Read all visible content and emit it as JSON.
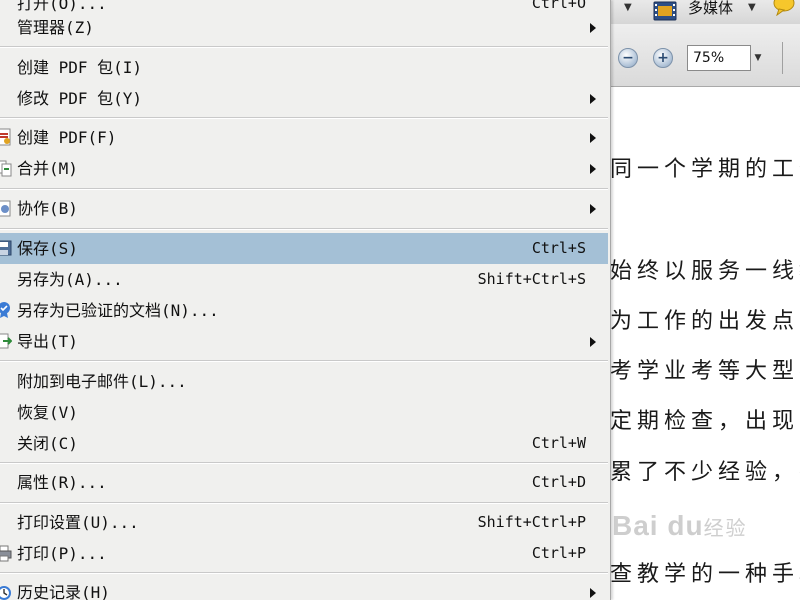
{
  "menu": {
    "items": [
      {
        "label": "打开(O)...",
        "shortcut": "Ctrl+O"
      },
      {
        "label": "管理器(Z)"
      },
      {
        "label": "创建 PDF 包(I)"
      },
      {
        "label": "修改 PDF 包(Y)"
      },
      {
        "label": "创建 PDF(F)"
      },
      {
        "label": "合并(M)"
      },
      {
        "label": "协作(B)"
      },
      {
        "label": "保存(S)",
        "shortcut": "Ctrl+S"
      },
      {
        "label": "另存为(A)...",
        "shortcut": "Shift+Ctrl+S"
      },
      {
        "label": "另存为已验证的文档(N)..."
      },
      {
        "label": "导出(T)"
      },
      {
        "label": "附加到电子邮件(L)..."
      },
      {
        "label": "恢复(V)"
      },
      {
        "label": "关闭(C)",
        "shortcut": "Ctrl+W"
      },
      {
        "label": "属性(R)...",
        "shortcut": "Ctrl+D"
      },
      {
        "label": "打印设置(U)...",
        "shortcut": "Shift+Ctrl+P"
      },
      {
        "label": "打印(P)...",
        "shortcut": "Ctrl+P"
      },
      {
        "label": "历史记录(H)"
      }
    ],
    "highlight_color": "#a4c0d6"
  },
  "toolbar": {
    "multimedia_label": "多媒体",
    "zoom_out_symbol": "−",
    "zoom_in_symbol": "+",
    "zoom_value": "75%"
  },
  "document": {
    "lines": [
      "同一个学期的工作",
      "始终以服务一线教",
      "为工作的出发点，",
      "考学业考等大型考",
      "定期检查，出现问",
      "累了不少经验，在",
      "查教学的一种手段"
    ]
  },
  "watermark": {
    "brand": "Bai du",
    "suffix": "经验"
  }
}
